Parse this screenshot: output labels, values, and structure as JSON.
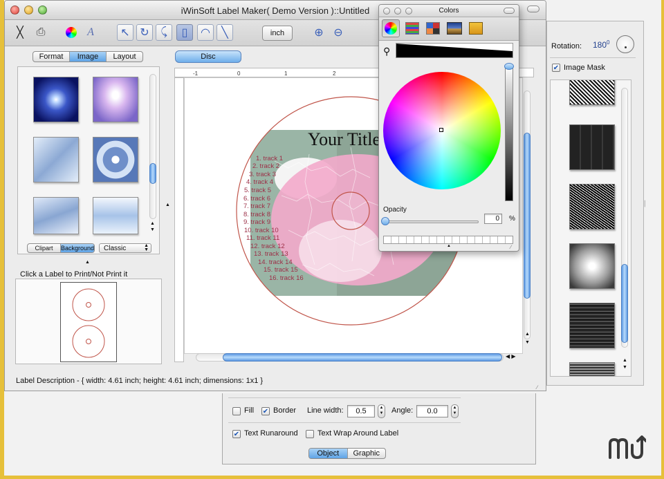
{
  "window": {
    "title": "iWinSoft Label Maker( Demo Version )::Untitled"
  },
  "toolbar": {
    "unit_button": "inch",
    "disc_button": "Disc"
  },
  "left_panel": {
    "tabs": [
      {
        "label": "Format"
      },
      {
        "label": "Image",
        "selected": true
      },
      {
        "label": "Layout"
      }
    ],
    "bottom_tabs": [
      {
        "label": "Clipart"
      },
      {
        "label": "Background",
        "selected": true
      }
    ],
    "style_select": "Classic",
    "print_hint": "Click a Label to Print/Not Print it"
  },
  "ruler": {
    "labels": [
      "-1",
      "0",
      "1",
      "2"
    ]
  },
  "disc": {
    "title": "Your Title",
    "tracks": [
      "1. track 1",
      "2. track 2",
      "3. track 3",
      "4. track 4",
      "5. track 5",
      "6. track 6",
      "7. track 7",
      "8. track 8",
      "9. track 9",
      "10. track 10",
      "11. track 11",
      "12. track 12",
      "13. track 13",
      "14. track 14",
      "15. track 15",
      "16. track 16"
    ],
    "accent_color": "#c0554a"
  },
  "status": {
    "label_description": "Label Description - { width: 4.61 inch; height: 4.61 inch; dimensions: 1x1 }"
  },
  "colors_panel": {
    "title": "Colors",
    "opacity_label": "Opacity",
    "opacity_value": "0",
    "opacity_unit": "%",
    "opacity_fraction": 0
  },
  "right_panel": {
    "rotation_label": "Rotation:",
    "rotation_value": "180",
    "rotation_sup": "0",
    "image_mask_label": "Image Mask",
    "image_mask_checked": true
  },
  "drawer": {
    "fill_label": "Fill",
    "fill_checked": false,
    "border_label": "Border",
    "border_checked": true,
    "line_width_label": "Line width:",
    "line_width_value": "0.5",
    "angle_label": "Angle:",
    "angle_value": "0.0",
    "text_runaround_label": "Text Runaround",
    "text_runaround_checked": true,
    "text_wrap_label": "Text Wrap Around Label",
    "text_wrap_checked": false,
    "tabs": [
      {
        "label": "Object",
        "selected": true
      },
      {
        "label": "Graphic"
      }
    ]
  },
  "colors": {
    "background": "#e6c03a",
    "aqua": "#5fa3e6",
    "disc_outline": "#c0554a",
    "track_text": "#9c2f47"
  }
}
